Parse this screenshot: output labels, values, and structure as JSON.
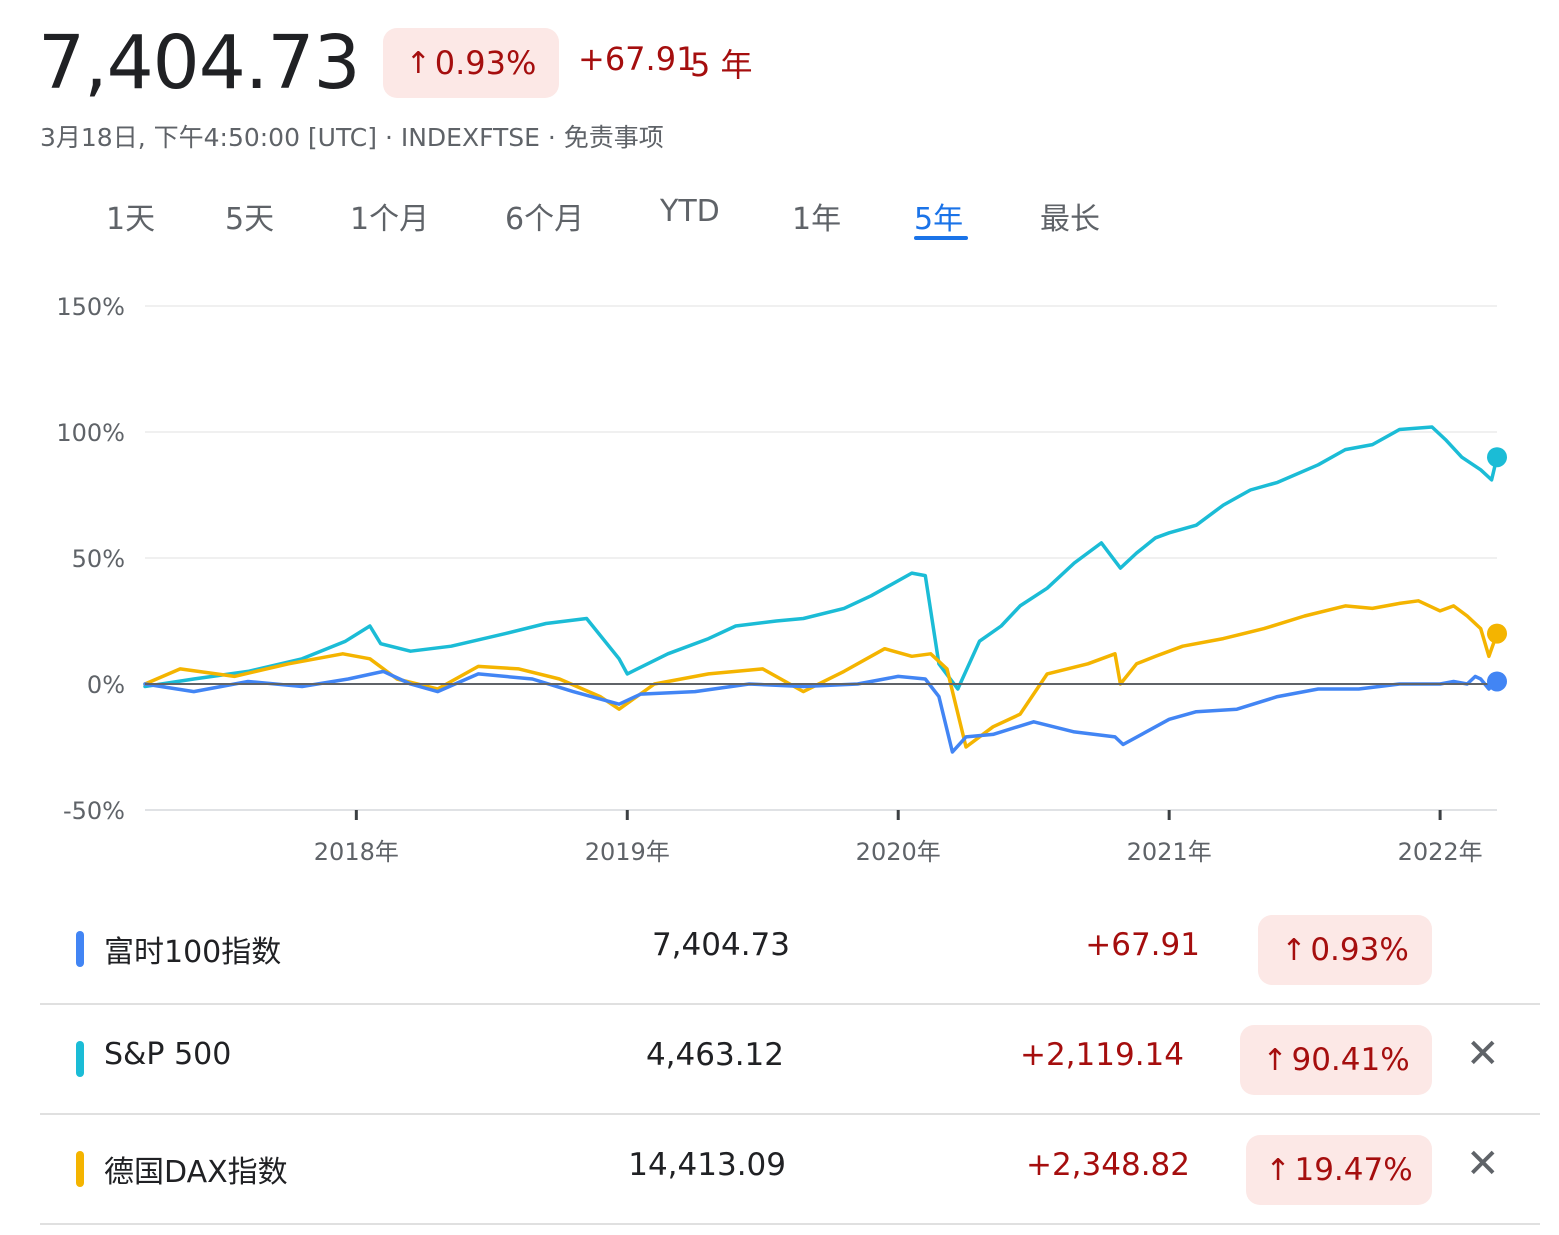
{
  "header": {
    "price": "7,404.73",
    "change_pct": "0.93%",
    "change_abs": "+67.91",
    "period": "5 年",
    "meta": "3月18日, 下午4:50:00 [UTC] · INDEXFTSE · 免责事项",
    "arrow_icon": "arrow-up-icon"
  },
  "tabs": [
    {
      "label": "1天"
    },
    {
      "label": "5天"
    },
    {
      "label": "1个月"
    },
    {
      "label": "6个月"
    },
    {
      "label": "YTD"
    },
    {
      "label": "1年"
    },
    {
      "label": "5年",
      "active": true
    },
    {
      "label": "最长"
    }
  ],
  "colors": {
    "ftse": "#4285f4",
    "sp500": "#1bbcd6",
    "dax": "#f4b400",
    "up_text": "#a50e0e",
    "up_bg": "#fce8e6",
    "active_tab": "#1a73e8"
  },
  "chart_data": {
    "type": "line",
    "y_ticks": [
      "150%",
      "100%",
      "50%",
      "0%",
      "-50%"
    ],
    "ylim": [
      -50,
      150
    ],
    "x_ticks": [
      "2018年",
      "2019年",
      "2020年",
      "2021年",
      "2022年"
    ],
    "x_tick_years": [
      2018.0,
      2019.0,
      2020.0,
      2021.0,
      2022.0
    ],
    "xlim": [
      2017.22,
      2022.21
    ],
    "grid": true,
    "series": [
      {
        "name": "S&P 500",
        "color": "#1bbcd6",
        "x": [
          2017.22,
          2017.4,
          2017.6,
          2017.8,
          2017.96,
          2018.05,
          2018.09,
          2018.2,
          2018.35,
          2018.55,
          2018.7,
          2018.85,
          2018.97,
          2019.0,
          2019.15,
          2019.3,
          2019.4,
          2019.55,
          2019.65,
          2019.8,
          2019.9,
          2020.05,
          2020.1,
          2020.15,
          2020.22,
          2020.3,
          2020.38,
          2020.45,
          2020.55,
          2020.65,
          2020.75,
          2020.82,
          2020.88,
          2020.95,
          2021.0,
          2021.1,
          2021.2,
          2021.3,
          2021.4,
          2021.55,
          2021.65,
          2021.75,
          2021.85,
          2021.97,
          2022.02,
          2022.08,
          2022.15,
          2022.19,
          2022.21
        ],
        "values": [
          -1,
          2,
          5,
          10,
          17,
          23,
          16,
          13,
          15,
          20,
          24,
          26,
          10,
          4,
          12,
          18,
          23,
          25,
          26,
          30,
          35,
          44,
          43,
          8,
          -2,
          17,
          23,
          31,
          38,
          48,
          56,
          46,
          52,
          58,
          60,
          63,
          71,
          77,
          80,
          87,
          93,
          95,
          101,
          102,
          97,
          90,
          85,
          81,
          90
        ]
      },
      {
        "name": "德国DAX指数",
        "color": "#f4b400",
        "x": [
          2017.22,
          2017.35,
          2017.55,
          2017.75,
          2017.95,
          2018.05,
          2018.15,
          2018.3,
          2018.45,
          2018.6,
          2018.75,
          2018.9,
          2018.97,
          2019.1,
          2019.3,
          2019.5,
          2019.65,
          2019.8,
          2019.95,
          2020.05,
          2020.12,
          2020.18,
          2020.25,
          2020.35,
          2020.45,
          2020.55,
          2020.7,
          2020.8,
          2020.82,
          2020.88,
          2020.95,
          2021.05,
          2021.2,
          2021.35,
          2021.5,
          2021.65,
          2021.75,
          2021.85,
          2021.92,
          2022.0,
          2022.05,
          2022.1,
          2022.15,
          2022.18,
          2022.21
        ],
        "values": [
          0,
          6,
          3,
          8,
          12,
          10,
          2,
          -2,
          7,
          6,
          2,
          -5,
          -10,
          0,
          4,
          6,
          -3,
          5,
          14,
          11,
          12,
          6,
          -25,
          -17,
          -12,
          4,
          8,
          12,
          0,
          8,
          11,
          15,
          18,
          22,
          27,
          31,
          30,
          32,
          33,
          29,
          31,
          27,
          22,
          11,
          20
        ]
      },
      {
        "name": "富时100指数",
        "color": "#4285f4",
        "x": [
          2017.22,
          2017.4,
          2017.6,
          2017.8,
          2017.97,
          2018.1,
          2018.2,
          2018.3,
          2018.45,
          2018.65,
          2018.8,
          2018.97,
          2019.05,
          2019.25,
          2019.45,
          2019.65,
          2019.85,
          2020.0,
          2020.1,
          2020.15,
          2020.2,
          2020.25,
          2020.35,
          2020.5,
          2020.65,
          2020.8,
          2020.83,
          2021.0,
          2021.1,
          2021.25,
          2021.4,
          2021.55,
          2021.7,
          2021.85,
          2022.0,
          2022.05,
          2022.1,
          2022.13,
          2022.15,
          2022.18,
          2022.21
        ],
        "values": [
          0,
          -3,
          1,
          -1,
          2,
          5,
          0,
          -3,
          4,
          2,
          -3,
          -8,
          -4,
          -3,
          0,
          -1,
          0,
          3,
          2,
          -5,
          -27,
          -21,
          -20,
          -15,
          -19,
          -21,
          -24,
          -14,
          -11,
          -10,
          -5,
          -2,
          -2,
          0,
          0,
          1,
          0,
          3,
          2,
          -2,
          1
        ]
      }
    ]
  },
  "table": {
    "rows": [
      {
        "name": "富时100指数",
        "value": "7,404.73",
        "change": "+67.91",
        "pct": "0.93%",
        "color": "#4285f4",
        "closable": false
      },
      {
        "name": "S&P  500",
        "value": "4,463.12",
        "change": "+2,119.14",
        "pct": "90.41%",
        "color": "#1bbcd6",
        "closable": true
      },
      {
        "name": "德国DAX指数",
        "value": "14,413.09",
        "change": "+2,348.82",
        "pct": "19.47%",
        "color": "#f4b400",
        "closable": true
      }
    ],
    "close_icon": "close-icon"
  }
}
